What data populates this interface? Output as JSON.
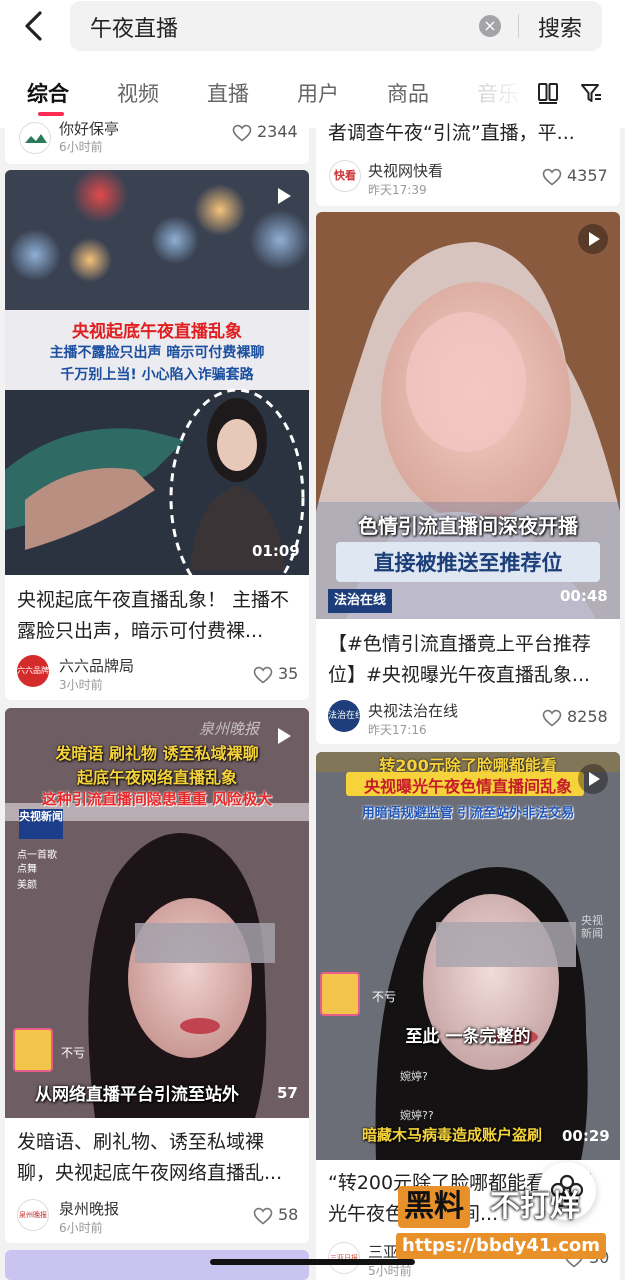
{
  "search": {
    "query": "午夜直播",
    "clear": "×",
    "button": "搜索"
  },
  "tabs": [
    "综合",
    "视频",
    "直播",
    "用户",
    "商品",
    "音乐"
  ],
  "cards": {
    "top_left": {
      "author": "你好保亭",
      "time": "6小时前",
      "likes": "2344"
    },
    "top_right": {
      "title": "者调查午夜“引流”直播，平...",
      "avatar_text": "快看",
      "author": "央视网快看",
      "time": "昨天17:39",
      "likes": "4357"
    },
    "left1": {
      "caption_red": "央视起底午夜直播乱象",
      "caption_blue1": "主播不露脸只出声 暗示可付费裸聊",
      "caption_blue2": "千万别上当! 小心陷入诈骗套路",
      "duration": "01:09",
      "title": "央视起底午夜直播乱象！ 主播不露脸只出声，暗示可付费裸...",
      "avatar_text": "六六品牌局",
      "author": "六六品牌局",
      "time": "3小时前",
      "likes": "35"
    },
    "right1": {
      "caption1": "色情引流直播间深夜开播",
      "caption2": "直接被推送至推荐位",
      "badge": "法治在线",
      "duration": "00:48",
      "title": "【#色情引流直播竟上平台推荐位】#央视曝光午夜直播乱象...",
      "avatar_text": "法治在线",
      "author": "央视法治在线",
      "time": "昨天17:16",
      "likes": "8258"
    },
    "left2": {
      "watermark": "泉州晚报",
      "caption1": "发暗语 刷礼物 诱至私域裸聊",
      "caption2": "起底午夜网络直播乱象",
      "caption3": "这种引流直播间隐患重重 风险极大",
      "logo": "央视新闻",
      "side_items": [
        "点一首歌",
        "点舞",
        "美颜"
      ],
      "gift_text": "不亏",
      "bottom_caption": "从网络直播平台引流至站外",
      "duration": "57",
      "title": "发暗语、刷礼物、诱至私域裸聊，央视起底午夜网络直播乱...",
      "avatar_text": "泉州晚报",
      "author": "泉州晚报",
      "time": "6小时前",
      "likes": "58"
    },
    "right2": {
      "top_partial": "转200元除了脸哪都能看",
      "caption1": "央视曝光午夜色情直播间乱象",
      "caption2": "用暗语规避监管 引流至站外非法交易",
      "logo": "央视新闻",
      "gift_text": "不亏",
      "mid_caption": "至此 一条完整的",
      "chat1": "婉婷?",
      "chat2": "婉婷??",
      "bottom_caption": "暗藏木马病毒造成账户盗刷",
      "duration": "00:29",
      "title": "“转200元除了脸哪都能看”视曝光午夜色情直播间...",
      "avatar_text": "三亚日报",
      "author": "三亚日报",
      "time": "5小时前",
      "likes": "30"
    }
  },
  "watermark": {
    "brand1": "黑料",
    "brand2": "不打烊",
    "url": "https://bbdy41.com"
  }
}
